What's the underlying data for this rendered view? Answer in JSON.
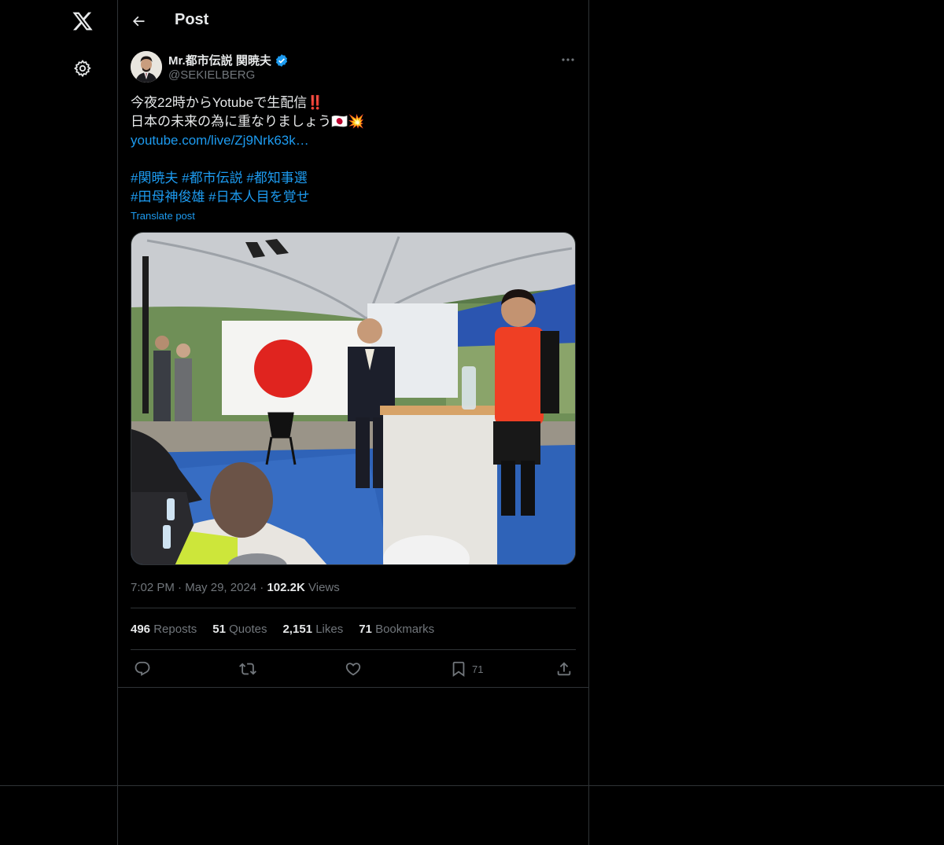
{
  "nav": {
    "logo_icon": "x-logo-icon",
    "settings_icon": "gear-icon"
  },
  "header": {
    "title": "Post"
  },
  "post": {
    "author": {
      "name": "Mr.都市伝説 関暁夫",
      "handle": "@SEKIELBERG",
      "verified": true
    },
    "text_lines": [
      "今夜22時からYotubeで生配信‼️",
      "日本の未来の為に重なりましょう🇯🇵💥"
    ],
    "link": "youtube.com/live/Zj9Nrk63k…",
    "hashtags_line1": "#関暁夫 #都市伝説 #都知事選",
    "hashtags_line2": "#田母神俊雄 #日本人目を覚せ",
    "translate_label": "Translate post",
    "time": "7:02 PM",
    "date": "May 29, 2024",
    "views_count": "102.2K",
    "views_label": "Views",
    "stats": {
      "reposts_count": "496",
      "reposts_label": "Reposts",
      "quotes_count": "51",
      "quotes_label": "Quotes",
      "likes_count": "2,151",
      "likes_label": "Likes",
      "bookmarks_count": "71",
      "bookmarks_label": "Bookmarks"
    },
    "actions": {
      "bookmark_count": "71"
    }
  },
  "colors": {
    "accent": "#1d9bf0",
    "background": "#000000",
    "border": "#2f3336",
    "muted": "#71767b",
    "text": "#e7e9ea"
  }
}
